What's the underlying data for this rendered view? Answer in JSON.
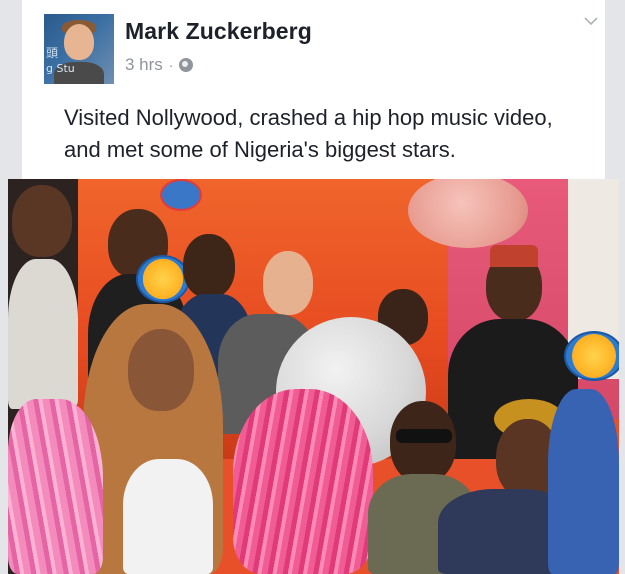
{
  "post": {
    "author_name": "Mark Zuckerberg",
    "timestamp": "3 hrs",
    "separator": "·",
    "audience_icon": "globe-icon",
    "options_icon": "chevron-down-icon",
    "text": "Visited Nollywood, crashed a hip hop music video, and met some of Nigeria's biggest stars.",
    "avatar_text_1": "頭",
    "avatar_text_2": "g  Stu"
  },
  "colors": {
    "card_background": "#ffffff",
    "page_background": "#e9ebee",
    "name_text": "#1d2129",
    "meta_text": "#90949c"
  }
}
